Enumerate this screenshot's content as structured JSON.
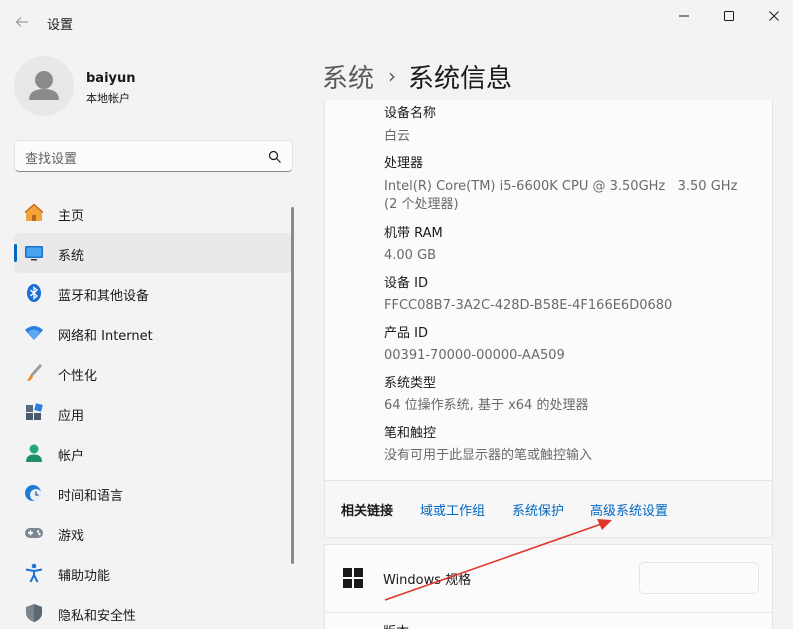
{
  "window": {
    "title": "设置",
    "back_icon": "back-arrow-icon",
    "controls": [
      "minimize-icon",
      "maximize-icon",
      "close-icon"
    ]
  },
  "profile": {
    "name": "baiyun",
    "account_type": "本地帐户"
  },
  "search": {
    "placeholder": "查找设置",
    "icon": "search-icon"
  },
  "sidebar": {
    "items": [
      {
        "label": "主页",
        "icon": "home-icon",
        "active": false
      },
      {
        "label": "系统",
        "icon": "system-icon",
        "active": true
      },
      {
        "label": "蓝牙和其他设备",
        "icon": "bluetooth-icon",
        "active": false
      },
      {
        "label": "网络和 Internet",
        "icon": "wifi-icon",
        "active": false
      },
      {
        "label": "个性化",
        "icon": "brush-icon",
        "active": false
      },
      {
        "label": "应用",
        "icon": "apps-icon",
        "active": false
      },
      {
        "label": "帐户",
        "icon": "account-icon",
        "active": false
      },
      {
        "label": "时间和语言",
        "icon": "clock-globe-icon",
        "active": false
      },
      {
        "label": "游戏",
        "icon": "gamepad-icon",
        "active": false
      },
      {
        "label": "辅助功能",
        "icon": "accessibility-icon",
        "active": false
      },
      {
        "label": "隐私和安全性",
        "icon": "shield-icon",
        "active": false
      }
    ]
  },
  "breadcrumb": {
    "parent": "系统",
    "separator": "›",
    "current": "系统信息"
  },
  "device_specs": {
    "rows": [
      {
        "label": "设备名称",
        "value": "白云"
      },
      {
        "label": "处理器",
        "value": "Intel(R) Core(TM) i5-6600K CPU @ 3.50GHz   3.50 GHz",
        "value2": "(2 个处理器)"
      },
      {
        "label": "机带 RAM",
        "value": "4.00 GB"
      },
      {
        "label": "设备 ID",
        "value": "FFCC08B7-3A2C-428D-B58E-4F166E6D0680"
      },
      {
        "label": "产品 ID",
        "value": "00391-70000-00000-AA509"
      },
      {
        "label": "系统类型",
        "value": "64 位操作系统, 基于 x64 的处理器"
      },
      {
        "label": "笔和触控",
        "value": "没有可用于此显示器的笔或触控输入"
      }
    ]
  },
  "related_links": {
    "label": "相关链接",
    "links": [
      "域或工作组",
      "系统保护",
      "高级系统设置"
    ]
  },
  "windows_spec": {
    "label": "Windows 规格",
    "icon": "windows-logo-icon"
  },
  "version": {
    "label": "版本"
  },
  "colors": {
    "accent": "#0067c0",
    "annotation_arrow": "#e0362c"
  }
}
